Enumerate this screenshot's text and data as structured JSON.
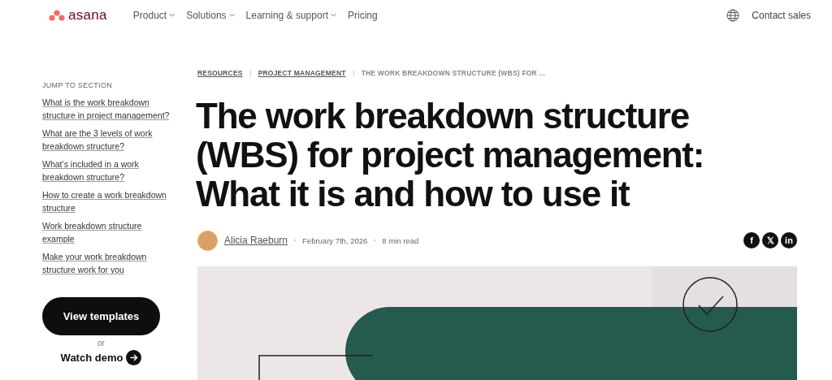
{
  "header": {
    "logo": "asana",
    "nav": [
      {
        "label": "Product",
        "dropdown": true
      },
      {
        "label": "Solutions",
        "dropdown": true
      },
      {
        "label": "Learning & support",
        "dropdown": true
      },
      {
        "label": "Pricing",
        "dropdown": false
      }
    ],
    "contact": "Contact sales"
  },
  "sidebar": {
    "heading": "JUMP TO SECTION",
    "links": [
      "What is the work breakdown structure in project management?",
      "What are the 3 levels of work breakdown structure?",
      "What’s included in a work breakdown structure?",
      "How to create a work breakdown structure",
      "Work breakdown structure example",
      "Make your work breakdown structure work for you"
    ],
    "primary_button": "View templates",
    "or": "or",
    "demo_link": "Watch demo"
  },
  "breadcrumbs": [
    {
      "label": "RESOURCES",
      "link": true
    },
    {
      "label": "PROJECT MANAGEMENT",
      "link": true
    },
    {
      "label": "THE WORK BREAKDOWN STRUCTURE (WBS) FOR ...",
      "link": false
    }
  ],
  "article": {
    "title": "The work breakdown structure (WBS) for project management: What it is and how to use it",
    "author": "Alicia Raeburn",
    "date": "February 7th, 2026",
    "read_time": "8 min read",
    "share": [
      "f",
      "𝕏",
      "in"
    ],
    "hero": {
      "kind": "picture"
    }
  }
}
